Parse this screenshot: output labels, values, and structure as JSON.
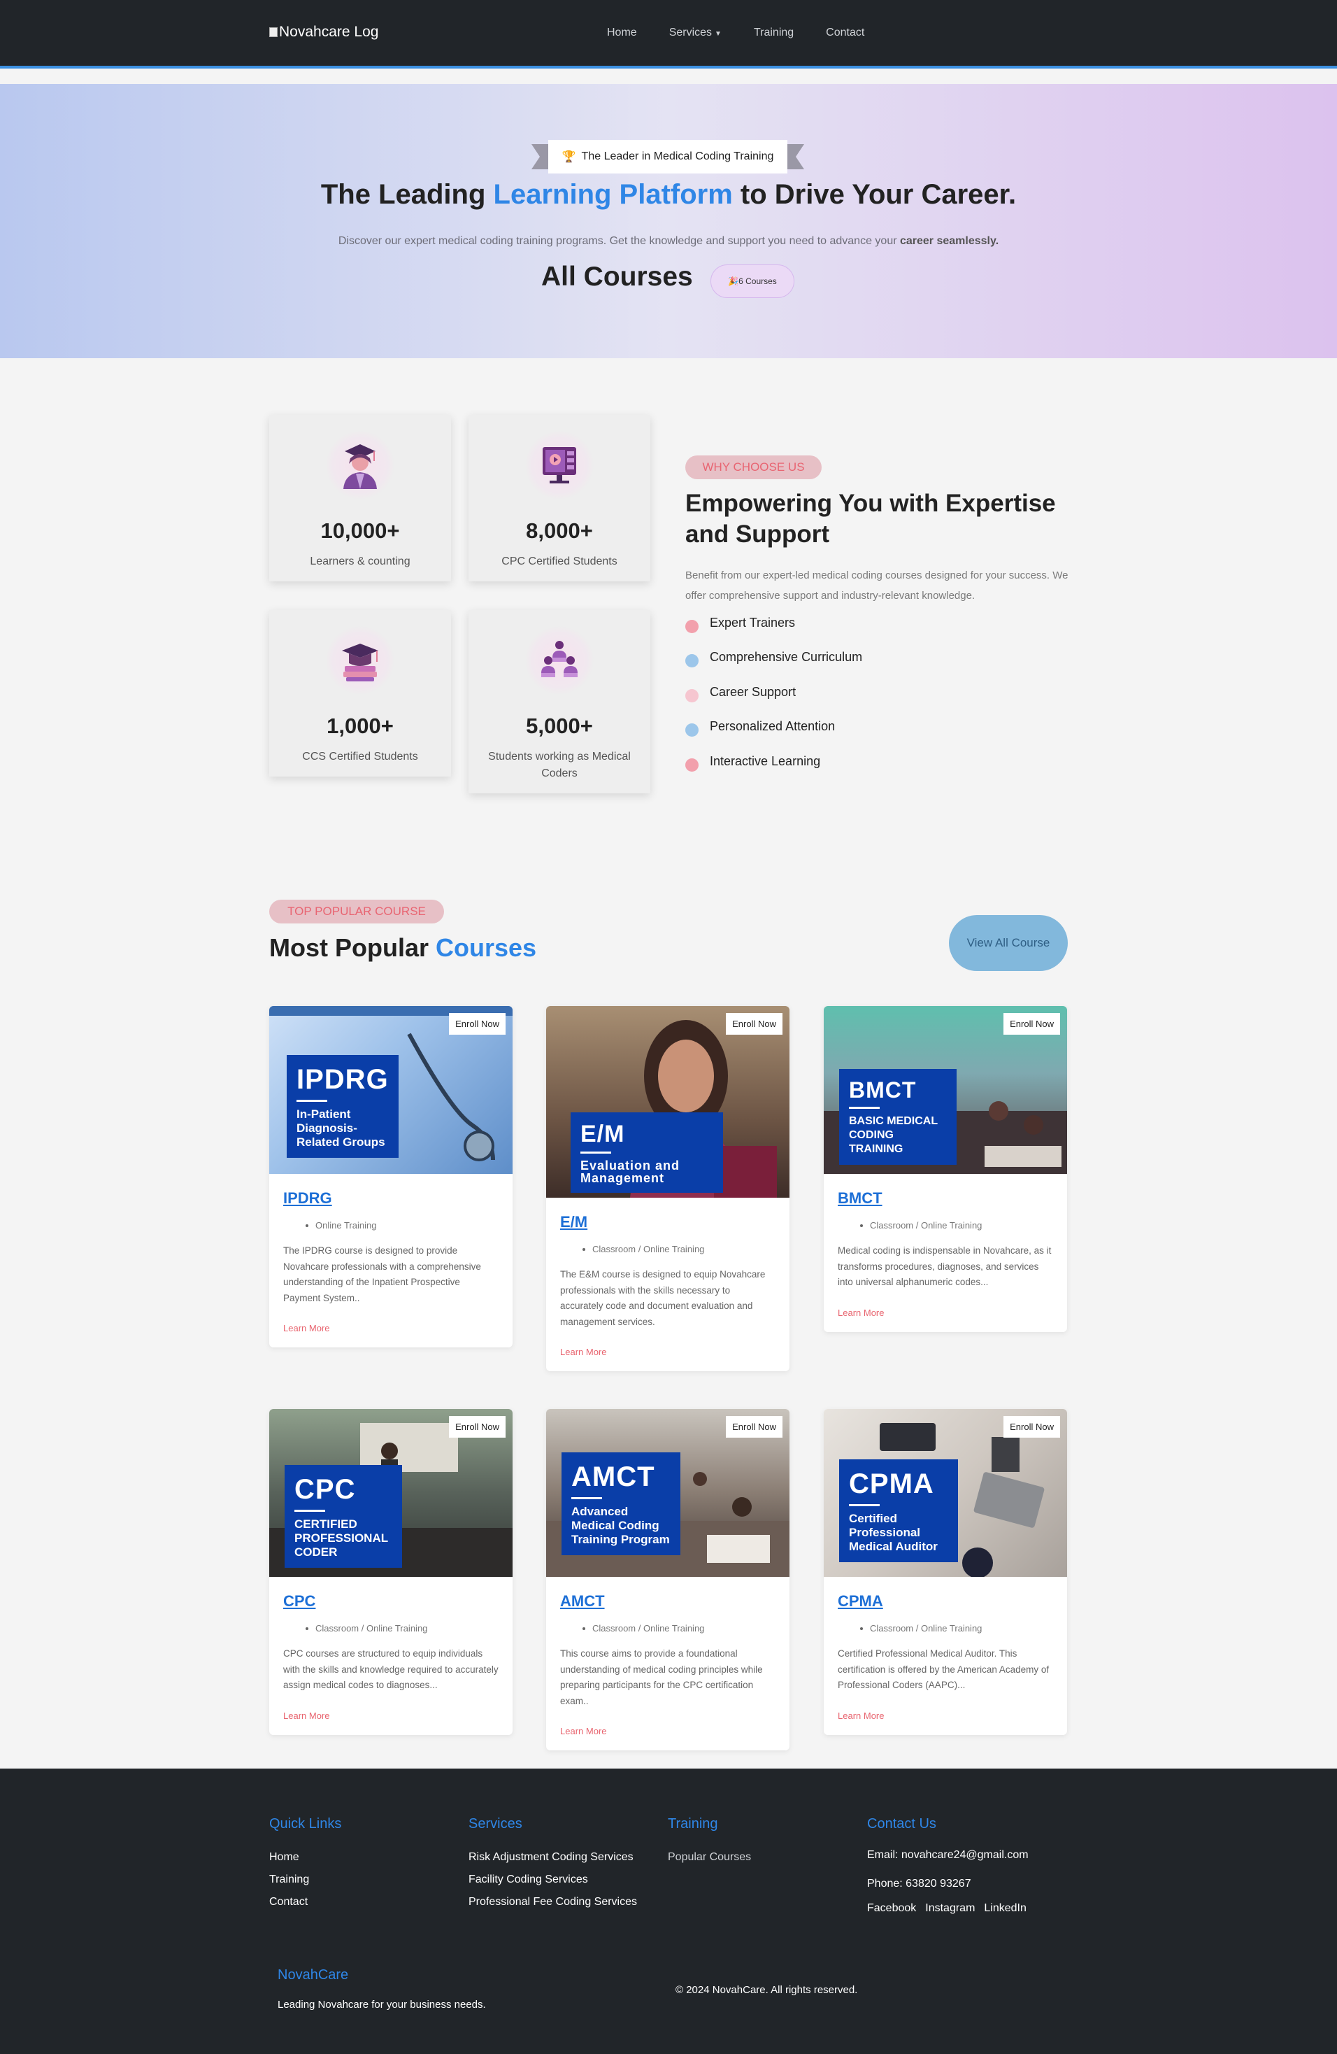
{
  "nav": {
    "logo_alt": "Novahcare Log",
    "links": [
      "Home",
      "Services",
      "Training",
      "Contact"
    ]
  },
  "hero": {
    "ribbon_icon": "🏆",
    "ribbon_text": "The Leader in Medical Coding Training",
    "title_a": "The Leading ",
    "title_b": "Learning Platform",
    "title_c": " to Drive Your Career.",
    "subtitle_a": "Discover our expert medical coding training programs. Get the knowledge and support you need to advance your ",
    "subtitle_b": "career seamlessly.",
    "all_courses": "All Courses",
    "count_pill": "🎉6 Courses"
  },
  "stats": [
    {
      "icon": "graduate-student-icon",
      "value": "10,000+",
      "label": "Learners & counting"
    },
    {
      "icon": "online-video-course-icon",
      "value": "8,000+",
      "label": "CPC Certified Students"
    },
    {
      "icon": "graduation-cap-books-icon",
      "value": "1,000+",
      "label": "CCS Certified Students"
    },
    {
      "icon": "team-classroom-icon",
      "value": "5,000+",
      "label": "Students working as Medical Coders"
    }
  ],
  "why": {
    "tag": "WHY CHOOSE US",
    "title": "Empowering You with Expertise and Support",
    "desc": "Benefit from our expert-led medical coding courses designed for your success. We offer comprehensive support and industry-relevant knowledge.",
    "features": [
      {
        "label": "Expert Trainers",
        "color": "#f2a0ac"
      },
      {
        "label": "Comprehensive Curriculum",
        "color": "#9cc6ea"
      },
      {
        "label": "Career Support",
        "color": "#f6c6d0"
      },
      {
        "label": "Personalized Attention",
        "color": "#9cc6ea"
      },
      {
        "label": "Interactive Learning",
        "color": "#f2a0ac"
      }
    ]
  },
  "popular": {
    "tag": "TOP POPULAR COURSE",
    "title_a": "Most Popular ",
    "title_b": "Courses",
    "view_all": "View All Course"
  },
  "courses": [
    {
      "badge_big": "IPDRG",
      "badge_small": "In-Patient Diagnosis-Related Groups",
      "enroll": "Enroll Now",
      "title": "IPDRG",
      "mode": "Online Training",
      "desc": "The IPDRG course is designed to provide Novahcare professionals with a comprehensive understanding of the Inpatient Prospective Payment System..",
      "more": "Learn More"
    },
    {
      "badge_big": "E/M",
      "badge_small": "Evaluation and Management",
      "enroll": "Enroll Now",
      "title": "E/M",
      "mode": "Classroom / Online Training",
      "desc": "The E&M course is designed to equip Novahcare professionals with the skills necessary to accurately code and document evaluation and management services.",
      "more": "Learn More"
    },
    {
      "badge_big": "BMCT",
      "badge_small": "BASIC MEDICAL CODING TRAINING",
      "enroll": "Enroll Now",
      "title": "BMCT",
      "mode": "Classroom / Online Training",
      "desc": "Medical coding is indispensable in Novahcare, as it transforms procedures, diagnoses, and services into universal alphanumeric codes...",
      "more": "Learn More"
    },
    {
      "badge_big": "CPC",
      "badge_small": "CERTIFIED PROFESSIONAL CODER",
      "enroll": "Enroll Now",
      "title": "CPC",
      "mode": "Classroom / Online Training",
      "desc": "CPC courses are structured to equip individuals with the skills and knowledge required to accurately assign medical codes to diagnoses...",
      "more": "Learn More"
    },
    {
      "badge_big": "AMCT",
      "badge_small": "Advanced Medical Coding Training Program",
      "enroll": "Enroll Now",
      "title": "AMCT",
      "mode": "Classroom / Online Training",
      "desc": "This course aims to provide a foundational understanding of medical coding principles while preparing participants for the CPC certification exam..",
      "more": "Learn More"
    },
    {
      "badge_big": "CPMA",
      "badge_small": "Certified Professional Medical Auditor",
      "enroll": "Enroll Now",
      "title": "CPMA",
      "mode": "Classroom / Online Training",
      "desc": "Certified Professional Medical Auditor. This certification is offered by the American Academy of Professional Coders (AAPC)...",
      "more": "Learn More"
    }
  ],
  "footer": {
    "quick_links": {
      "title": "Quick Links",
      "items": [
        "Home",
        "Training",
        "Contact"
      ]
    },
    "services": {
      "title": "Services",
      "items": [
        "Risk Adjustment Coding Services",
        "Facility Coding Services",
        "Professional Fee Coding Services"
      ]
    },
    "training": {
      "title": "Training",
      "items": [
        "Popular Courses"
      ]
    },
    "contact": {
      "title": "Contact Us",
      "email": "Email: novahcare24@gmail.com",
      "phone": "Phone: 63820 93267",
      "social": [
        "Facebook",
        "Instagram",
        "LinkedIn"
      ]
    },
    "brand": "NovahCare",
    "brand_tagline": "Leading Novahcare for your business needs.",
    "copyright": "© 2024 NovahCare. All rights reserved."
  }
}
